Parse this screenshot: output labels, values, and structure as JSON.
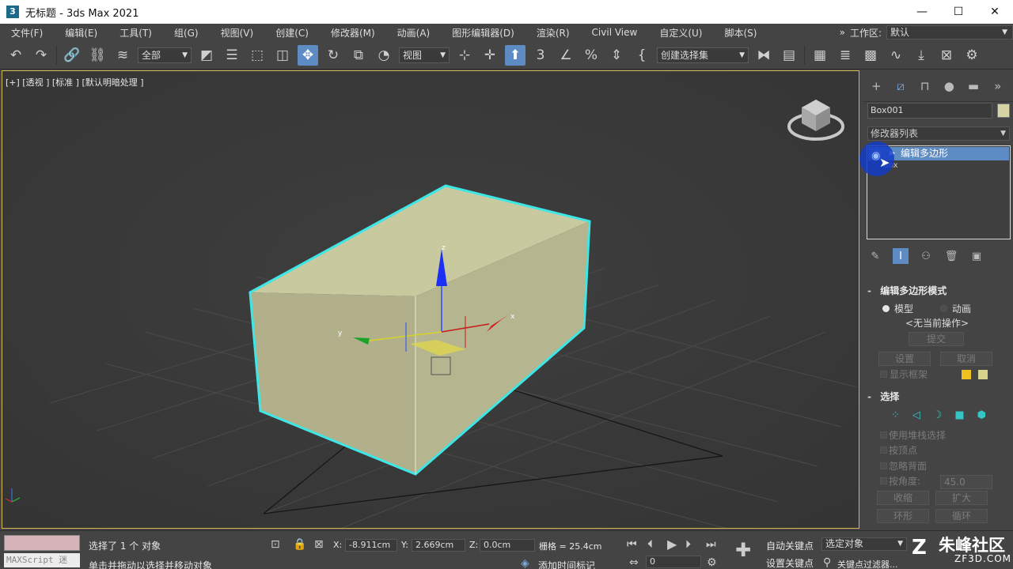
{
  "window": {
    "title": "无标题 - 3ds Max 2021",
    "app_icon": "3",
    "min_glyph": "—",
    "max_glyph": "☐",
    "close_glyph": "✕"
  },
  "menubar": {
    "items": [
      "文件(F)",
      "编辑(E)",
      "工具(T)",
      "组(G)",
      "视图(V)",
      "创建(C)",
      "修改器(M)",
      "动画(A)",
      "图形编辑器(D)",
      "渲染(R)",
      "Civil View",
      "自定义(U)",
      "脚本(S)"
    ],
    "overflow": "»",
    "workspace_label": "工作区:",
    "workspace_value": "默认"
  },
  "toolbar": {
    "selection_filter": "全部",
    "ref_coord": "视图",
    "named_selection": "创建选择集"
  },
  "viewport": {
    "label": "[+] [透视 ] [标准 ] [默认明暗处理 ]",
    "gizmo_z": "z",
    "gizmo_x": "x",
    "gizmo_y": "y"
  },
  "command_panel": {
    "object_name": "Box001",
    "object_color": "#d6d4a2",
    "modifier_list": "修改器列表",
    "stack": {
      "selected": "编辑多边形",
      "base": "Box"
    },
    "rollout_edit_poly": {
      "title": "编辑多边形模式",
      "radio_model": "模型",
      "radio_anim": "动画",
      "no_current_op": "<无当前操作>",
      "commit": "提交",
      "settings": "设置",
      "cancel": "取消",
      "show_cage": "显示框架"
    },
    "rollout_selection": {
      "title": "选择",
      "use_stack_sel": "使用堆栈选择",
      "by_vertex": "按顶点",
      "ignore_backfacing": "忽略背面",
      "by_angle": "按角度:",
      "angle_value": "45.0",
      "shrink": "收缩",
      "grow": "扩大",
      "ring": "环形",
      "loop": "循环"
    }
  },
  "statusbar": {
    "maxscript": "MAXScript 迷",
    "selected": "选择了 1 个 对象",
    "prompt": "单击并拖动以选择并移动对象",
    "x_label": "X:",
    "x_value": "-8.911cm",
    "y_label": "Y:",
    "y_value": "2.669cm",
    "z_label": "Z:",
    "z_value": "0.0cm",
    "grid": "栅格 = 25.4cm",
    "add_time_tag": "添加时间标记",
    "frame": "0",
    "auto_key": "自动关键点",
    "set_key": "设置关键点",
    "selected_objects": "选定对象",
    "key_filters": "关键点过滤器..."
  },
  "watermark": {
    "name": "朱峰社区",
    "site": "ZF3D.COM"
  },
  "colors": {
    "accent": "#5d8bc4",
    "box_top": "#c9c9a0",
    "box_side": "#b1b08b",
    "selection_outline": "#3ee6e6"
  }
}
